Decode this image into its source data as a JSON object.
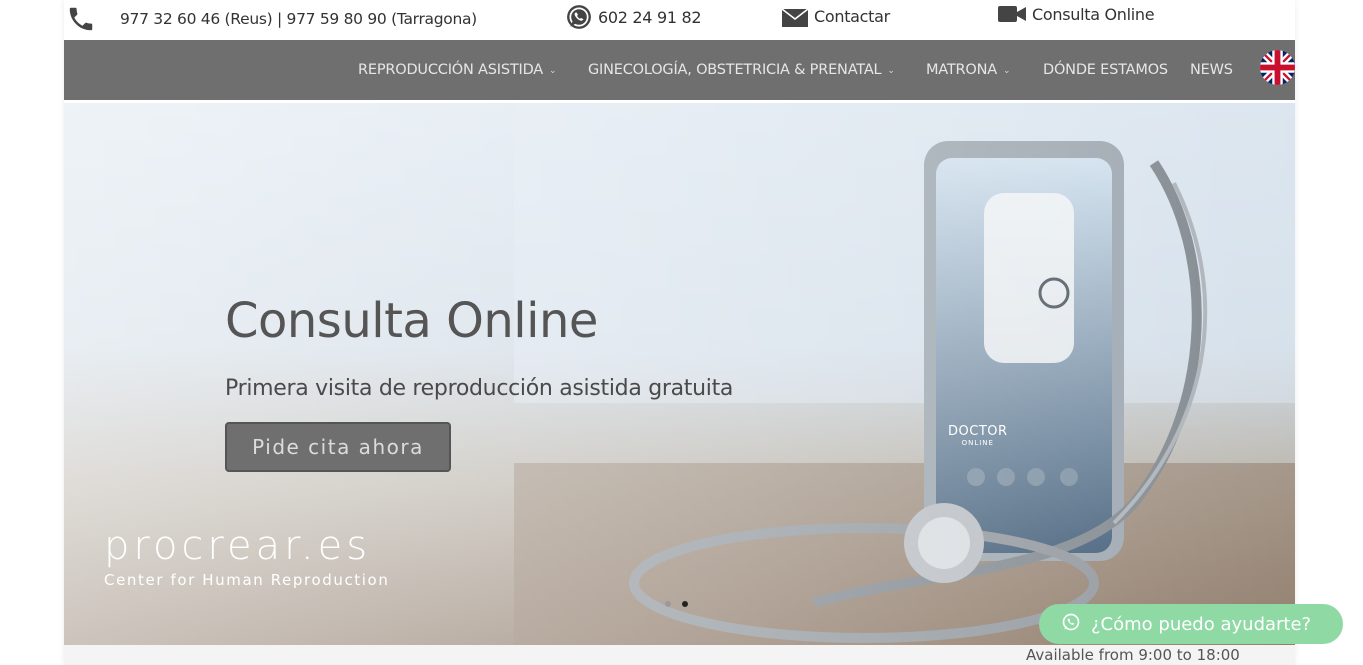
{
  "topbar": {
    "phone_text": "977 32 60 46 (Reus) | 977 59 80 90 (Tarragona)",
    "whatsapp_text": "602 24 91 82",
    "contact_text": "Contactar",
    "consult_text": "Consulta Online",
    "icons": [
      "phone-icon",
      "whatsapp-icon",
      "mail-icon",
      "video-camera-icon"
    ]
  },
  "nav": {
    "items": [
      {
        "label": "REPRODUCCIÓN ASISTIDA",
        "has_dropdown": true
      },
      {
        "label": "GINECOLOGÍA, OBSTETRICIA & PRENATAL",
        "has_dropdown": true
      },
      {
        "label": "MATRONA",
        "has_dropdown": true
      },
      {
        "label": "DÓNDE ESTAMOS",
        "has_dropdown": false
      },
      {
        "label": "NEWS",
        "has_dropdown": false
      }
    ],
    "chevron": "⌄",
    "language_flag": "uk-flag-icon"
  },
  "hero": {
    "title": "Consulta Online",
    "subtitle": "Primera visita de reproducción asistida gratuita",
    "button_label": "Pide cita ahora",
    "phone_screen_text": "DOCTOR",
    "phone_screen_subtext": "ONLINE",
    "slides_total": 2,
    "active_slide": 2
  },
  "logo": {
    "name": "procrear.es",
    "tagline": "Center for Human Reproduction"
  },
  "whatsapp_widget": {
    "label": "¿Cómo puedo ayudarte?",
    "availability": "Available from 9:00 to 18:00"
  },
  "colors": {
    "nav_bg": "#6f6f6f",
    "nav_text": "#e6e6e6",
    "button_bg": "#6f6f6f",
    "whatsapp_green": "#8fd9a4"
  }
}
